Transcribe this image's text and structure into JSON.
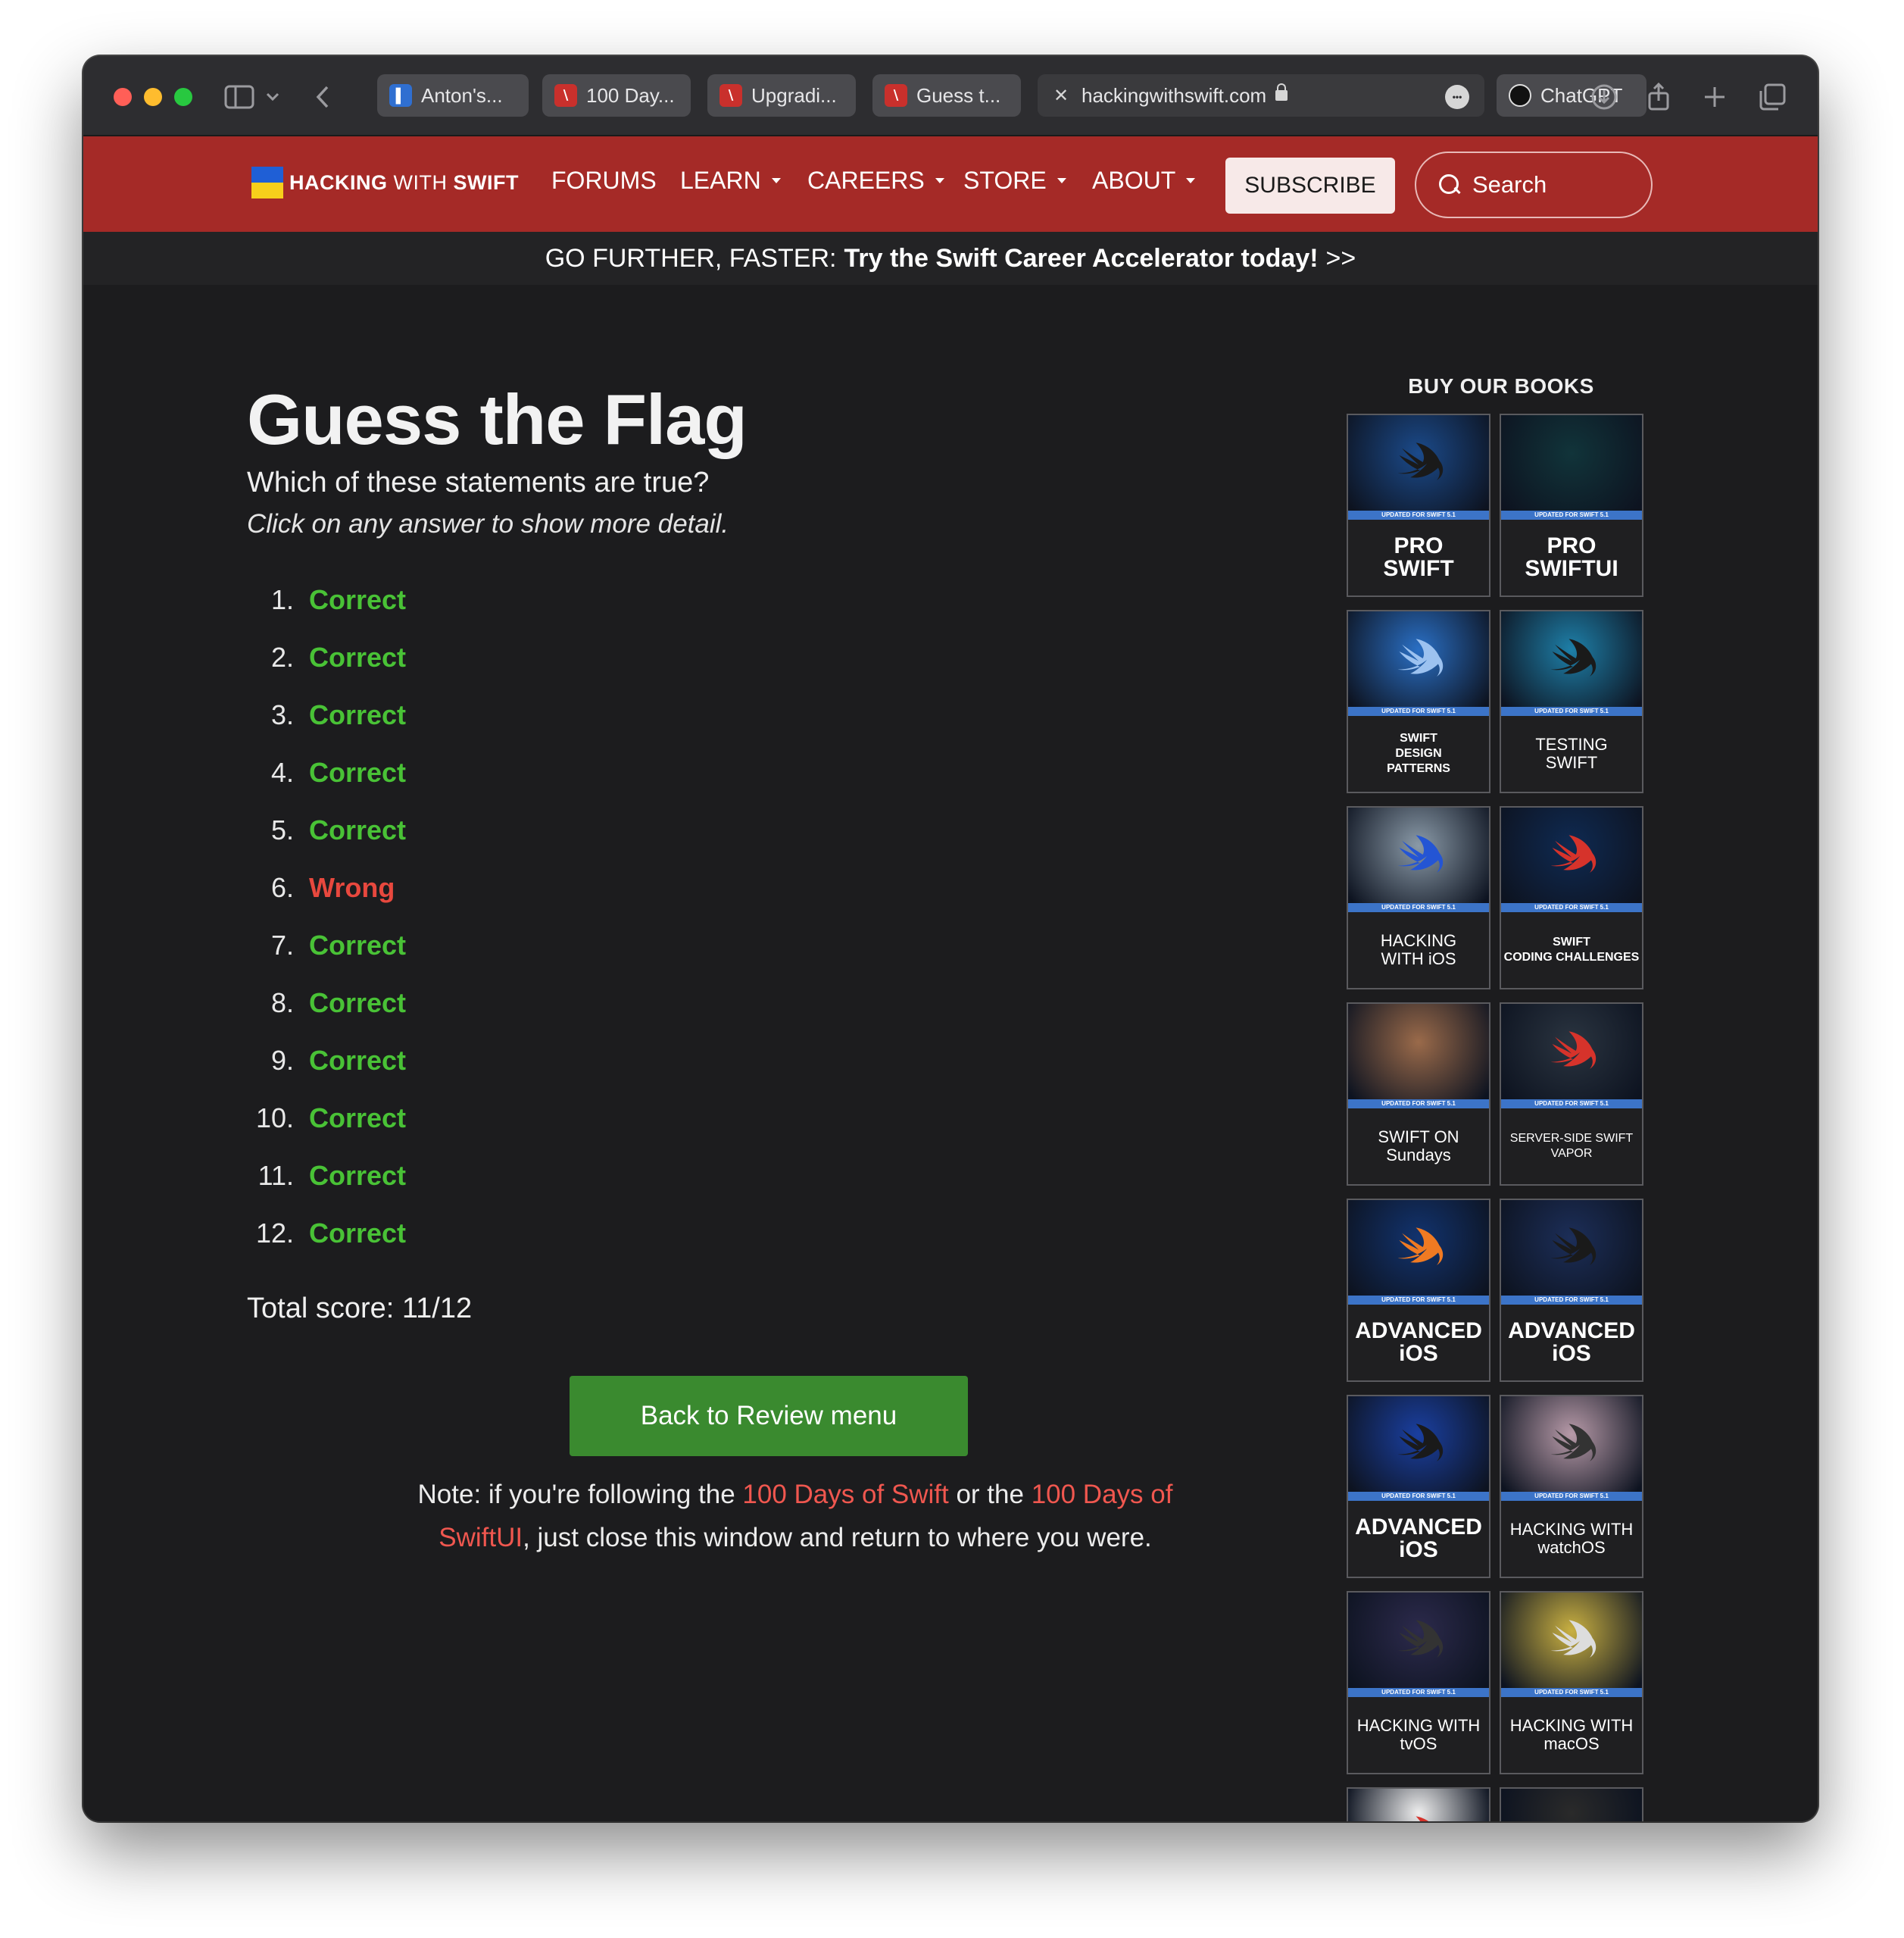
{
  "browser": {
    "tabs": [
      {
        "label": "Anton's...",
        "favicon": "trello-icon"
      },
      {
        "label": "100 Day...",
        "favicon": "hws-icon"
      },
      {
        "label": "Upgradi...",
        "favicon": "hws-icon"
      },
      {
        "label": "Guess t...",
        "favicon": "hws-icon"
      },
      {
        "label": "hackingwithswift.com",
        "favicon": "close-icon",
        "active": true
      },
      {
        "label": "ChatGPT",
        "favicon": "chatgpt-icon"
      }
    ]
  },
  "nav": {
    "logo_hacking": "HACKING",
    "logo_with": "WITH",
    "logo_swift": "SWIFT",
    "items": [
      "FORUMS",
      "LEARN",
      "CAREERS",
      "STORE",
      "ABOUT"
    ],
    "subscribe": "SUBSCRIBE",
    "search_placeholder": "Search"
  },
  "promo": {
    "lead": "GO FURTHER, FASTER:",
    "cta": "Try the Swift Career Accelerator today!",
    "arrows": ">>"
  },
  "main": {
    "title": "Guess the Flag",
    "subtitle": "Which of these statements are true?",
    "hint": "Click on any answer to show more detail.",
    "answers": [
      {
        "num": "1.",
        "result": "Correct"
      },
      {
        "num": "2.",
        "result": "Correct"
      },
      {
        "num": "3.",
        "result": "Correct"
      },
      {
        "num": "4.",
        "result": "Correct"
      },
      {
        "num": "5.",
        "result": "Correct"
      },
      {
        "num": "6.",
        "result": "Wrong"
      },
      {
        "num": "7.",
        "result": "Correct"
      },
      {
        "num": "8.",
        "result": "Correct"
      },
      {
        "num": "9.",
        "result": "Correct"
      },
      {
        "num": "10.",
        "result": "Correct"
      },
      {
        "num": "11.",
        "result": "Correct"
      },
      {
        "num": "12.",
        "result": "Correct"
      }
    ],
    "score": "Total score: 11/12",
    "back_button": "Back to Review menu",
    "note": {
      "p1": "Note: if you're following the ",
      "link1": "100 Days of Swift",
      "p2": " or the ",
      "link2": "100 Days of SwiftUI",
      "p3": ", just close this window and return to where you were."
    }
  },
  "sidebar": {
    "heading": "BUY OUR BOOKS",
    "strip_label": "UPDATED FOR SWIFT 5.1",
    "books": [
      {
        "title": "PRO\nSWIFT",
        "style": "big",
        "bg": "#1b4a8a",
        "bird": "#1a1a1a"
      },
      {
        "title": "PRO\nSWIFTUI",
        "style": "big",
        "bg": "#11343a",
        "bird": "none"
      },
      {
        "title": "SWIFT\nDESIGN\nPATTERNS",
        "style": "big",
        "bg": "#2a6fc4",
        "bird": "#9cc2f0"
      },
      {
        "title": "TESTING\nSWIFT",
        "style": "small",
        "bg": "#1e7fa8",
        "bird": "#1a1a1a"
      },
      {
        "title": "HACKING\nWITH iOS",
        "style": "small",
        "bg": "#8a9aa8",
        "bird": "#2455d4"
      },
      {
        "title": "SWIFT\nCODING CHALLENGES",
        "style": "big",
        "bg": "#0f2a52",
        "bird": "#d6332b"
      },
      {
        "title": "SWIFT ON\nSundays",
        "style": "small",
        "bg": "#9a6a4a",
        "bird": "none"
      },
      {
        "title": "SERVER-SIDE SWIFT\nVAPOR",
        "style": "small",
        "bg": "#2a3440",
        "bird": "#d6332b"
      },
      {
        "title": "ADVANCED\niOS",
        "style": "big",
        "bg": "#12336e",
        "bird": "#f07a22"
      },
      {
        "title": "ADVANCED\niOS",
        "style": "big",
        "bg": "#1c2e58",
        "bird": "#1a1a1a"
      },
      {
        "title": "ADVANCED\niOS",
        "style": "big",
        "bg": "#1a3fa0",
        "bird": "#1a1a1a"
      },
      {
        "title": "HACKING WITH\nwatchOS",
        "style": "small",
        "bg": "#b79aa8",
        "bird": "#333333"
      },
      {
        "title": "HACKING WITH\ntvOS",
        "style": "small",
        "bg": "#2c2a4c",
        "bird": "#333333"
      },
      {
        "title": "HACKING WITH\nmacOS",
        "style": "small",
        "bg": "#c9b042",
        "bird": "#dddddd"
      },
      {
        "title": "",
        "style": "small",
        "bg": "#eeeeee",
        "bird": "#d6332b"
      },
      {
        "title": "",
        "style": "small",
        "bg": "#2a2a2a",
        "bird": "none"
      }
    ]
  },
  "colors": {
    "brand_red": "#a52a27",
    "correct": "#49c236",
    "wrong": "#e8483e",
    "button_green": "#3a8a2f",
    "link": "#f0574f"
  }
}
